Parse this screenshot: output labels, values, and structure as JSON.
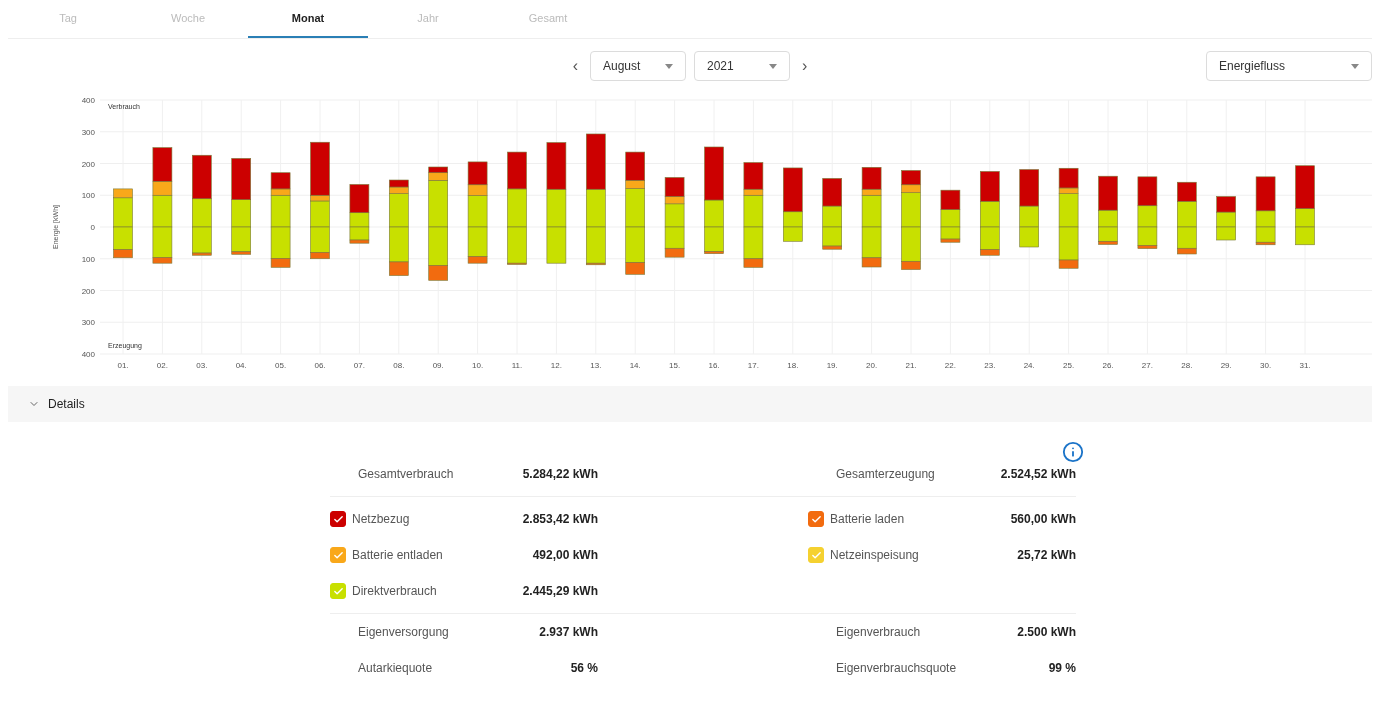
{
  "tabs": [
    {
      "label": "Tag",
      "selected": false
    },
    {
      "label": "Woche",
      "selected": false
    },
    {
      "label": "Monat",
      "selected": true
    },
    {
      "label": "Jahr",
      "selected": false
    },
    {
      "label": "Gesamt",
      "selected": false
    }
  ],
  "period": {
    "prev": "‹",
    "month": "August",
    "year": "2021",
    "next": "›"
  },
  "view_select": "Energiefluss",
  "chart_data": {
    "type": "bar",
    "stacked": true,
    "ylabel": "Energie [kWh]",
    "categories": [
      "01.",
      "02.",
      "03.",
      "04.",
      "05.",
      "06.",
      "07.",
      "08.",
      "09.",
      "10.",
      "11.",
      "12.",
      "13.",
      "14.",
      "15.",
      "16.",
      "17.",
      "18.",
      "19.",
      "20.",
      "21.",
      "22.",
      "23.",
      "24.",
      "25.",
      "26.",
      "27.",
      "28.",
      "29.",
      "30.",
      "31."
    ],
    "ylim": [
      -400,
      400
    ],
    "yticks": [
      {
        "value": -400,
        "label": "400"
      },
      {
        "value": -300,
        "label": "300"
      },
      {
        "value": -200,
        "label": "200"
      },
      {
        "value": -100,
        "label": "100"
      },
      0,
      100,
      200,
      300,
      400
    ],
    "grid": true,
    "annotations": [
      "Verbrauch",
      "Erzeugung"
    ],
    "series": [
      {
        "color": "#c8e000",
        "values": [
          92,
          100,
          89,
          86,
          100,
          82,
          45,
          105,
          147,
          99,
          120,
          119,
          119,
          121,
          73,
          85,
          100,
          48,
          66,
          100,
          108,
          55,
          81,
          66,
          105,
          53,
          67,
          81,
          47,
          51,
          58
        ]
      },
      {
        "color": "#f9a81a",
        "values": [
          28,
          44,
          0,
          0,
          20,
          18,
          0,
          21,
          24,
          34,
          0,
          0,
          0,
          26,
          23,
          0,
          19,
          0,
          0,
          19,
          25,
          0,
          0,
          0,
          18,
          0,
          0,
          0,
          0,
          0,
          0
        ]
      },
      {
        "color": "#cc0000",
        "values": [
          0,
          106,
          137,
          130,
          51,
          167,
          89,
          22,
          18,
          72,
          116,
          147,
          174,
          89,
          60,
          167,
          84,
          138,
          87,
          69,
          45,
          61,
          94,
          115,
          62,
          107,
          91,
          60,
          49,
          107,
          135
        ]
      },
      {
        "color": "#c8e000",
        "values": [
          -71,
          -96,
          -82,
          -78,
          -99,
          -80,
          -41,
          -110,
          -121,
          -93,
          -114,
          -114,
          -114,
          -112,
          -67,
          -77,
          -100,
          -45,
          -60,
          -97,
          -108,
          -38,
          -71,
          -63,
          -104,
          -45,
          -58,
          -67,
          -41,
          -48,
          -56
        ]
      },
      {
        "color": "#f26b0f",
        "values": [
          -26,
          -18,
          -7,
          -8,
          -28,
          -20,
          -10,
          -43,
          -47,
          -21,
          -4,
          0,
          -5,
          -37,
          -28,
          -7,
          -27,
          0,
          -10,
          -29,
          -26,
          -10,
          -18,
          0,
          -26,
          -10,
          -10,
          -18,
          0,
          -8,
          0
        ]
      }
    ]
  },
  "details": {
    "title": "Details",
    "expanded": true,
    "summary": [
      {
        "label": "Gesamtverbrauch",
        "value": "5.284,22 kWh"
      },
      {
        "label": "Gesamterzeugung",
        "value": "2.524,52 kWh"
      }
    ],
    "legend_left": [
      {
        "label": "Netzbezug",
        "value": "2.853,42 kWh",
        "color": "#cc0000",
        "checked": true
      },
      {
        "label": "Batterie entladen",
        "value": "492,00 kWh",
        "color": "#f9a81a",
        "checked": true
      },
      {
        "label": "Direktverbrauch",
        "value": "2.445,29 kWh",
        "color": "#c8e000",
        "checked": true
      }
    ],
    "legend_right": [
      {
        "label": "Batterie laden",
        "value": "560,00 kWh",
        "color": "#f26b0f",
        "checked": true
      },
      {
        "label": "Netzeinspeisung",
        "value": "25,72 kWh",
        "color": "#f5d130",
        "checked": true
      }
    ],
    "totals_left": [
      {
        "label": "Eigenversorgung",
        "value": "2.937 kWh"
      },
      {
        "label": "Autarkiequote",
        "value": "56 %"
      }
    ],
    "totals_right": [
      {
        "label": "Eigenverbrauch",
        "value": "2.500 kWh"
      },
      {
        "label": "Eigenverbrauchsquote",
        "value": "99 %"
      }
    ]
  }
}
